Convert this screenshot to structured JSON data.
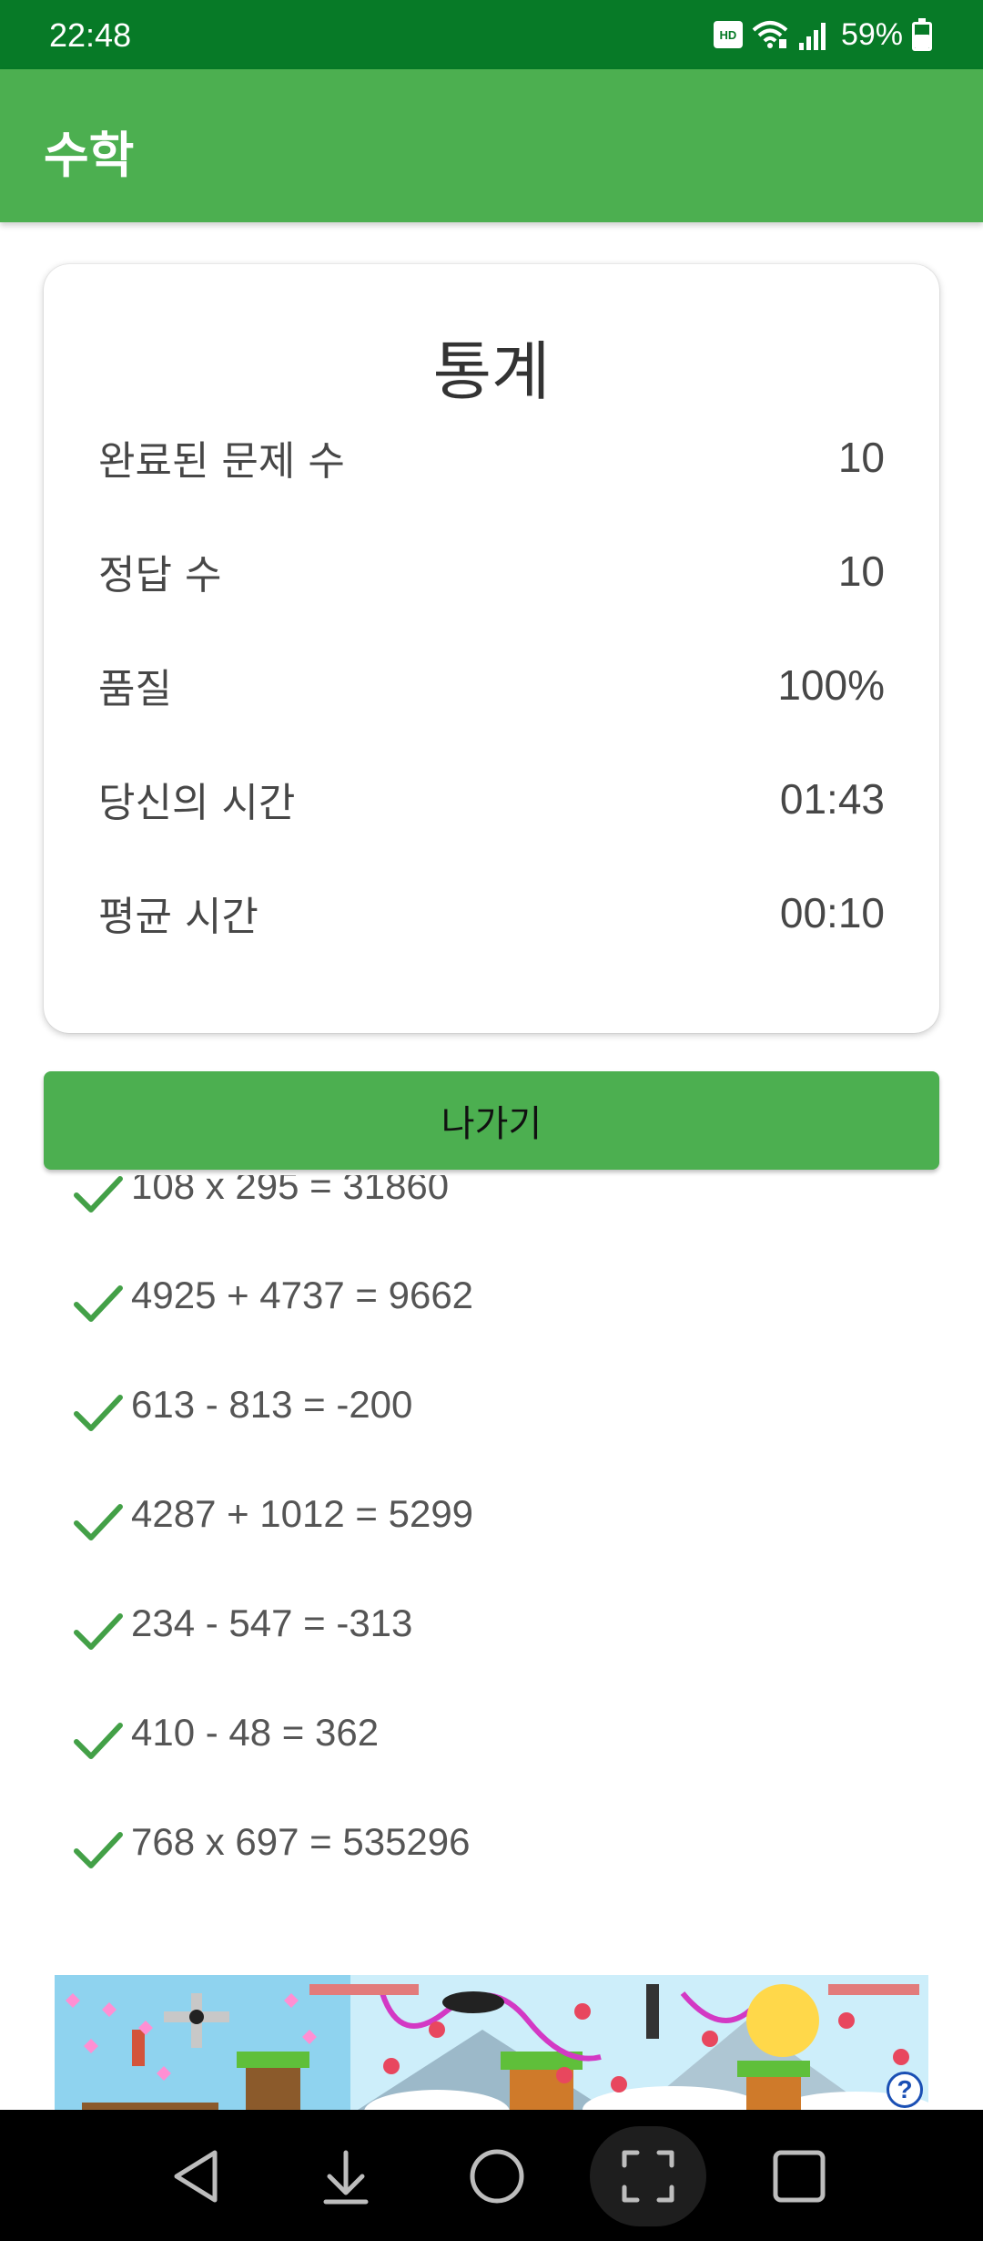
{
  "status_bar": {
    "time": "22:48",
    "hd_voice": "HD",
    "battery_text": "59%",
    "battery_level": 0.59,
    "background": "#077a27"
  },
  "app_bar": {
    "title": "수학",
    "background": "#4caf50"
  },
  "stats": {
    "title": "통계",
    "rows": [
      {
        "label": "완료된 문제 수",
        "value": "10"
      },
      {
        "label": "정답 수",
        "value": "10"
      },
      {
        "label": "품질",
        "value": "100%"
      },
      {
        "label": "당신의 시간",
        "value": "01:43"
      },
      {
        "label": "평균 시간",
        "value": "00:10"
      }
    ]
  },
  "exit_button": {
    "label": "나가기",
    "color": "#4caf50"
  },
  "results": [
    {
      "text": "108 x 295 = 31860",
      "correct": true
    },
    {
      "text": "4925 + 4737 = 9662",
      "correct": true
    },
    {
      "text": "613 - 813 = -200",
      "correct": true
    },
    {
      "text": "4287 + 1012 = 5299",
      "correct": true
    },
    {
      "text": "234 - 547 = -313",
      "correct": true
    },
    {
      "text": "410 - 48 = 362",
      "correct": true
    },
    {
      "text": "768 x 697 = 535296",
      "correct": true
    }
  ],
  "check_color": "#43a047",
  "ad": {
    "help_label": "?"
  },
  "nav_bar": {
    "buttons": [
      {
        "name": "back-icon"
      },
      {
        "name": "download-icon"
      },
      {
        "name": "home-icon"
      },
      {
        "name": "screenshot-icon"
      },
      {
        "name": "recents-icon"
      }
    ]
  }
}
